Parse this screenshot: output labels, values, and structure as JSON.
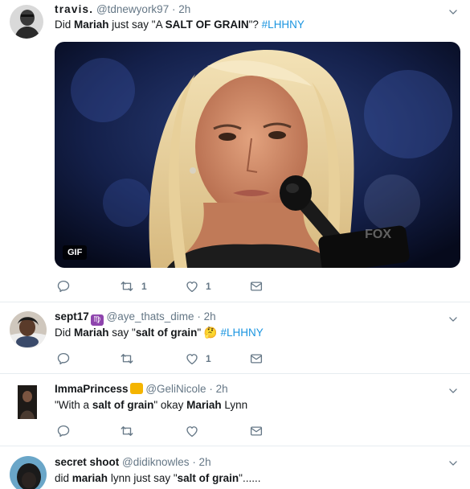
{
  "tweets": [
    {
      "name": "travis.",
      "handle": "@tdnewyork97",
      "time": "· 2h",
      "text_parts": [
        "Did ",
        "Mariah",
        " just say \"A ",
        "SALT OF GRAIN",
        "\"? ",
        "#LHHNY"
      ],
      "media": {
        "badge": "GIF",
        "watermark": "FOX"
      },
      "actions": {
        "reply": "",
        "retweet": "1",
        "like": "1",
        "dm": ""
      }
    },
    {
      "name": "sept17",
      "handle": "@aye_thats_dime",
      "time": "· 2h",
      "text_parts": [
        "Did ",
        "Mariah",
        " say \"",
        "salt of grain",
        "\" ",
        "🤔",
        " ",
        "#LHHNY"
      ],
      "actions": {
        "reply": "",
        "retweet": "",
        "like": "1",
        "dm": ""
      }
    },
    {
      "name": "ImmaPrincess",
      "handle": "@GeliNicole",
      "time": "· 2h",
      "text_parts": [
        "\"With a ",
        "salt of grain",
        "\" okay ",
        "Mariah",
        " Lynn"
      ],
      "actions": {
        "reply": "",
        "retweet": "",
        "like": "",
        "dm": ""
      }
    },
    {
      "name": "secret shoot",
      "handle": "@didiknowles",
      "time": "· 2h",
      "text_parts": [
        "did ",
        "mariah",
        " lynn just say \"",
        "salt of grain",
        "\"......"
      ]
    }
  ],
  "colors": {
    "accent": "#1b95e0",
    "muted": "#657786",
    "text": "#14171a",
    "divider": "#e6ecf0"
  },
  "icons": {
    "reply": "reply-icon",
    "retweet": "retweet-icon",
    "like": "heart-icon",
    "dm": "envelope-icon",
    "caret": "chevron-down-icon"
  }
}
